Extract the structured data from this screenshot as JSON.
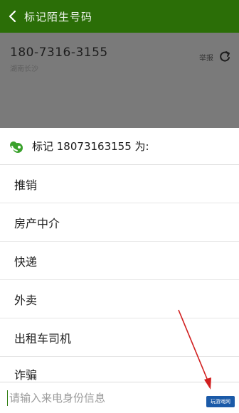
{
  "topbar": {
    "title": "标记陌生号码"
  },
  "contact": {
    "number": "180-7316-3155",
    "sub_label": "湖南长沙",
    "report_label": "举报"
  },
  "sheet": {
    "title": "标记 18073163155 为:",
    "options": [
      "推销",
      "房产中介",
      "快递",
      "外卖",
      "出租车司机",
      "诈骗"
    ]
  },
  "input": {
    "placeholder": "请输入来电身份信息"
  },
  "watermark": {
    "text": "玩游戏网"
  },
  "colors": {
    "topbar": "#2b6e07",
    "overlay": "#7a7a7a",
    "arrow": "#d11f1f",
    "accent": "#3aa12c"
  }
}
